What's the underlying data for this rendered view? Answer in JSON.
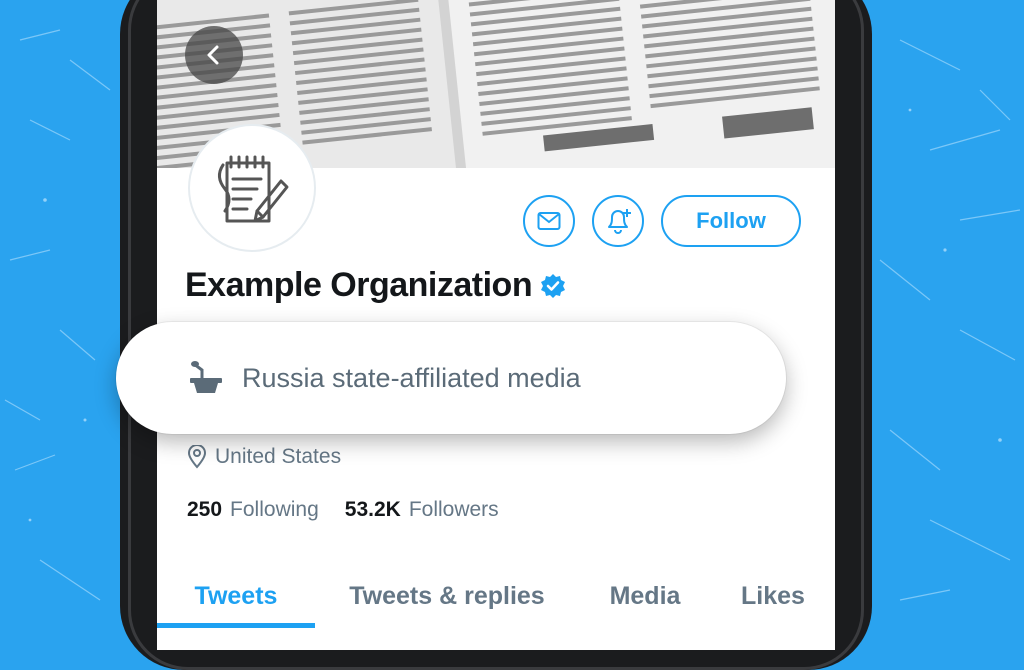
{
  "profile": {
    "name": "Example Organization",
    "label": "Russia state-affiliated media",
    "location": "United States",
    "following_count": "250",
    "following_label": "Following",
    "followers_count": "53.2K",
    "followers_label": "Followers"
  },
  "actions": {
    "follow_label": "Follow"
  },
  "tabs": [
    {
      "label": "Tweets",
      "active": true
    },
    {
      "label": "Tweets & replies",
      "active": false
    },
    {
      "label": "Media",
      "active": false
    },
    {
      "label": "Likes",
      "active": false
    }
  ],
  "icons": {
    "back": "chevron-left-icon",
    "message": "envelope-icon",
    "notifications": "bell-plus-icon",
    "verified": "verified-badge-icon",
    "label": "podium-icon",
    "location": "map-pin-icon",
    "avatar": "notepad-pen-icon"
  },
  "colors": {
    "brand": "#1da1f2",
    "background": "#2aa3ef",
    "text_primary": "#14171a",
    "text_secondary": "#657786"
  }
}
